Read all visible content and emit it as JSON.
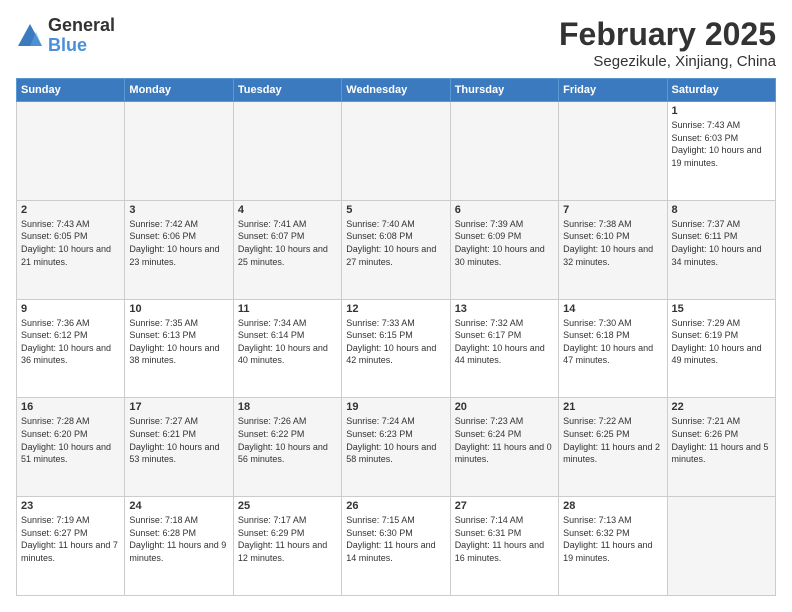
{
  "header": {
    "logo_general": "General",
    "logo_blue": "Blue",
    "month_title": "February 2025",
    "subtitle": "Segezikule, Xinjiang, China"
  },
  "weekdays": [
    "Sunday",
    "Monday",
    "Tuesday",
    "Wednesday",
    "Thursday",
    "Friday",
    "Saturday"
  ],
  "weeks": [
    [
      {
        "day": "",
        "info": ""
      },
      {
        "day": "",
        "info": ""
      },
      {
        "day": "",
        "info": ""
      },
      {
        "day": "",
        "info": ""
      },
      {
        "day": "",
        "info": ""
      },
      {
        "day": "",
        "info": ""
      },
      {
        "day": "1",
        "info": "Sunrise: 7:43 AM\nSunset: 6:03 PM\nDaylight: 10 hours and 19 minutes."
      }
    ],
    [
      {
        "day": "2",
        "info": "Sunrise: 7:43 AM\nSunset: 6:05 PM\nDaylight: 10 hours and 21 minutes."
      },
      {
        "day": "3",
        "info": "Sunrise: 7:42 AM\nSunset: 6:06 PM\nDaylight: 10 hours and 23 minutes."
      },
      {
        "day": "4",
        "info": "Sunrise: 7:41 AM\nSunset: 6:07 PM\nDaylight: 10 hours and 25 minutes."
      },
      {
        "day": "5",
        "info": "Sunrise: 7:40 AM\nSunset: 6:08 PM\nDaylight: 10 hours and 27 minutes."
      },
      {
        "day": "6",
        "info": "Sunrise: 7:39 AM\nSunset: 6:09 PM\nDaylight: 10 hours and 30 minutes."
      },
      {
        "day": "7",
        "info": "Sunrise: 7:38 AM\nSunset: 6:10 PM\nDaylight: 10 hours and 32 minutes."
      },
      {
        "day": "8",
        "info": "Sunrise: 7:37 AM\nSunset: 6:11 PM\nDaylight: 10 hours and 34 minutes."
      }
    ],
    [
      {
        "day": "9",
        "info": "Sunrise: 7:36 AM\nSunset: 6:12 PM\nDaylight: 10 hours and 36 minutes."
      },
      {
        "day": "10",
        "info": "Sunrise: 7:35 AM\nSunset: 6:13 PM\nDaylight: 10 hours and 38 minutes."
      },
      {
        "day": "11",
        "info": "Sunrise: 7:34 AM\nSunset: 6:14 PM\nDaylight: 10 hours and 40 minutes."
      },
      {
        "day": "12",
        "info": "Sunrise: 7:33 AM\nSunset: 6:15 PM\nDaylight: 10 hours and 42 minutes."
      },
      {
        "day": "13",
        "info": "Sunrise: 7:32 AM\nSunset: 6:17 PM\nDaylight: 10 hours and 44 minutes."
      },
      {
        "day": "14",
        "info": "Sunrise: 7:30 AM\nSunset: 6:18 PM\nDaylight: 10 hours and 47 minutes."
      },
      {
        "day": "15",
        "info": "Sunrise: 7:29 AM\nSunset: 6:19 PM\nDaylight: 10 hours and 49 minutes."
      }
    ],
    [
      {
        "day": "16",
        "info": "Sunrise: 7:28 AM\nSunset: 6:20 PM\nDaylight: 10 hours and 51 minutes."
      },
      {
        "day": "17",
        "info": "Sunrise: 7:27 AM\nSunset: 6:21 PM\nDaylight: 10 hours and 53 minutes."
      },
      {
        "day": "18",
        "info": "Sunrise: 7:26 AM\nSunset: 6:22 PM\nDaylight: 10 hours and 56 minutes."
      },
      {
        "day": "19",
        "info": "Sunrise: 7:24 AM\nSunset: 6:23 PM\nDaylight: 10 hours and 58 minutes."
      },
      {
        "day": "20",
        "info": "Sunrise: 7:23 AM\nSunset: 6:24 PM\nDaylight: 11 hours and 0 minutes."
      },
      {
        "day": "21",
        "info": "Sunrise: 7:22 AM\nSunset: 6:25 PM\nDaylight: 11 hours and 2 minutes."
      },
      {
        "day": "22",
        "info": "Sunrise: 7:21 AM\nSunset: 6:26 PM\nDaylight: 11 hours and 5 minutes."
      }
    ],
    [
      {
        "day": "23",
        "info": "Sunrise: 7:19 AM\nSunset: 6:27 PM\nDaylight: 11 hours and 7 minutes."
      },
      {
        "day": "24",
        "info": "Sunrise: 7:18 AM\nSunset: 6:28 PM\nDaylight: 11 hours and 9 minutes."
      },
      {
        "day": "25",
        "info": "Sunrise: 7:17 AM\nSunset: 6:29 PM\nDaylight: 11 hours and 12 minutes."
      },
      {
        "day": "26",
        "info": "Sunrise: 7:15 AM\nSunset: 6:30 PM\nDaylight: 11 hours and 14 minutes."
      },
      {
        "day": "27",
        "info": "Sunrise: 7:14 AM\nSunset: 6:31 PM\nDaylight: 11 hours and 16 minutes."
      },
      {
        "day": "28",
        "info": "Sunrise: 7:13 AM\nSunset: 6:32 PM\nDaylight: 11 hours and 19 minutes."
      },
      {
        "day": "",
        "info": ""
      }
    ]
  ]
}
